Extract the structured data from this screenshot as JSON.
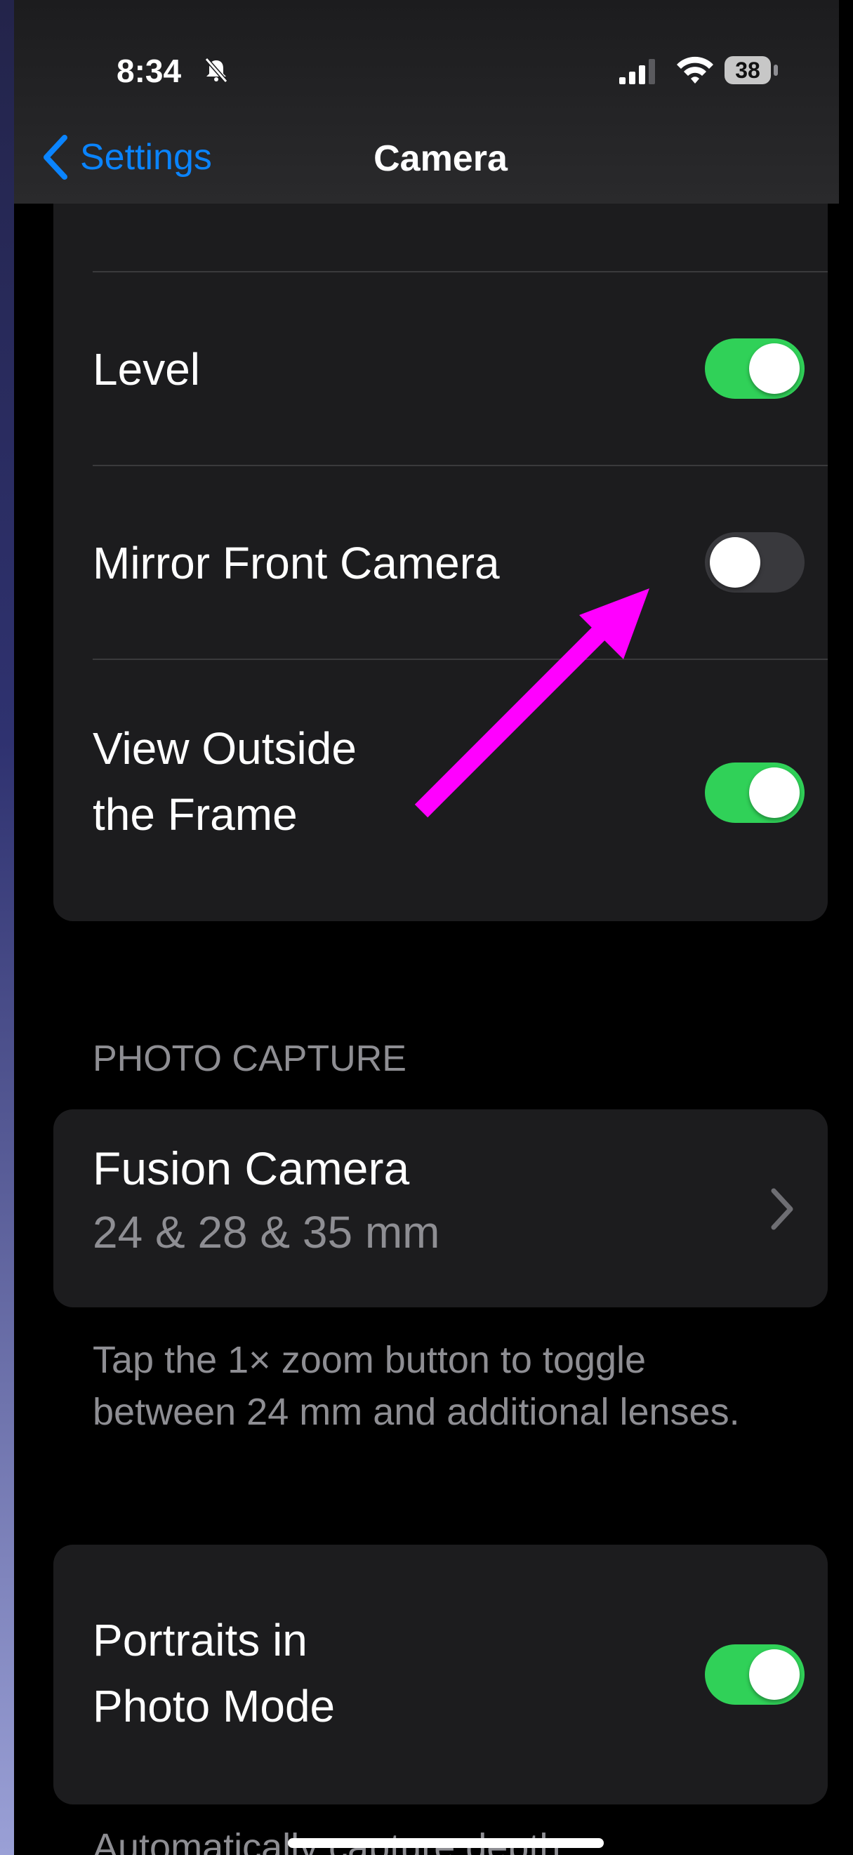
{
  "status_bar": {
    "time": "8:34",
    "battery": "38"
  },
  "nav": {
    "back_label": "Settings",
    "title": "Camera"
  },
  "group1": {
    "rows": [
      {
        "label": "Level",
        "toggle": "on"
      },
      {
        "label": "Mirror Front Camera",
        "toggle": "off"
      },
      {
        "label_line1": "View Outside",
        "label_line2": "the Frame",
        "toggle": "on"
      }
    ]
  },
  "photo_capture": {
    "header": "PHOTO CAPTURE",
    "fusion_title": "Fusion Camera",
    "fusion_subtitle": "24 & 28 & 35 mm",
    "footnote": "Tap the 1× zoom button to toggle between 24 mm and additional lenses."
  },
  "portraits": {
    "label_line1": "Portraits in",
    "label_line2": "Photo Mode",
    "toggle": "on"
  },
  "bottom_text": "Automatically capture depth",
  "colors": {
    "accent_blue": "#0a84ff",
    "toggle_green": "#30d158",
    "annotation_magenta": "#ff00ff"
  }
}
